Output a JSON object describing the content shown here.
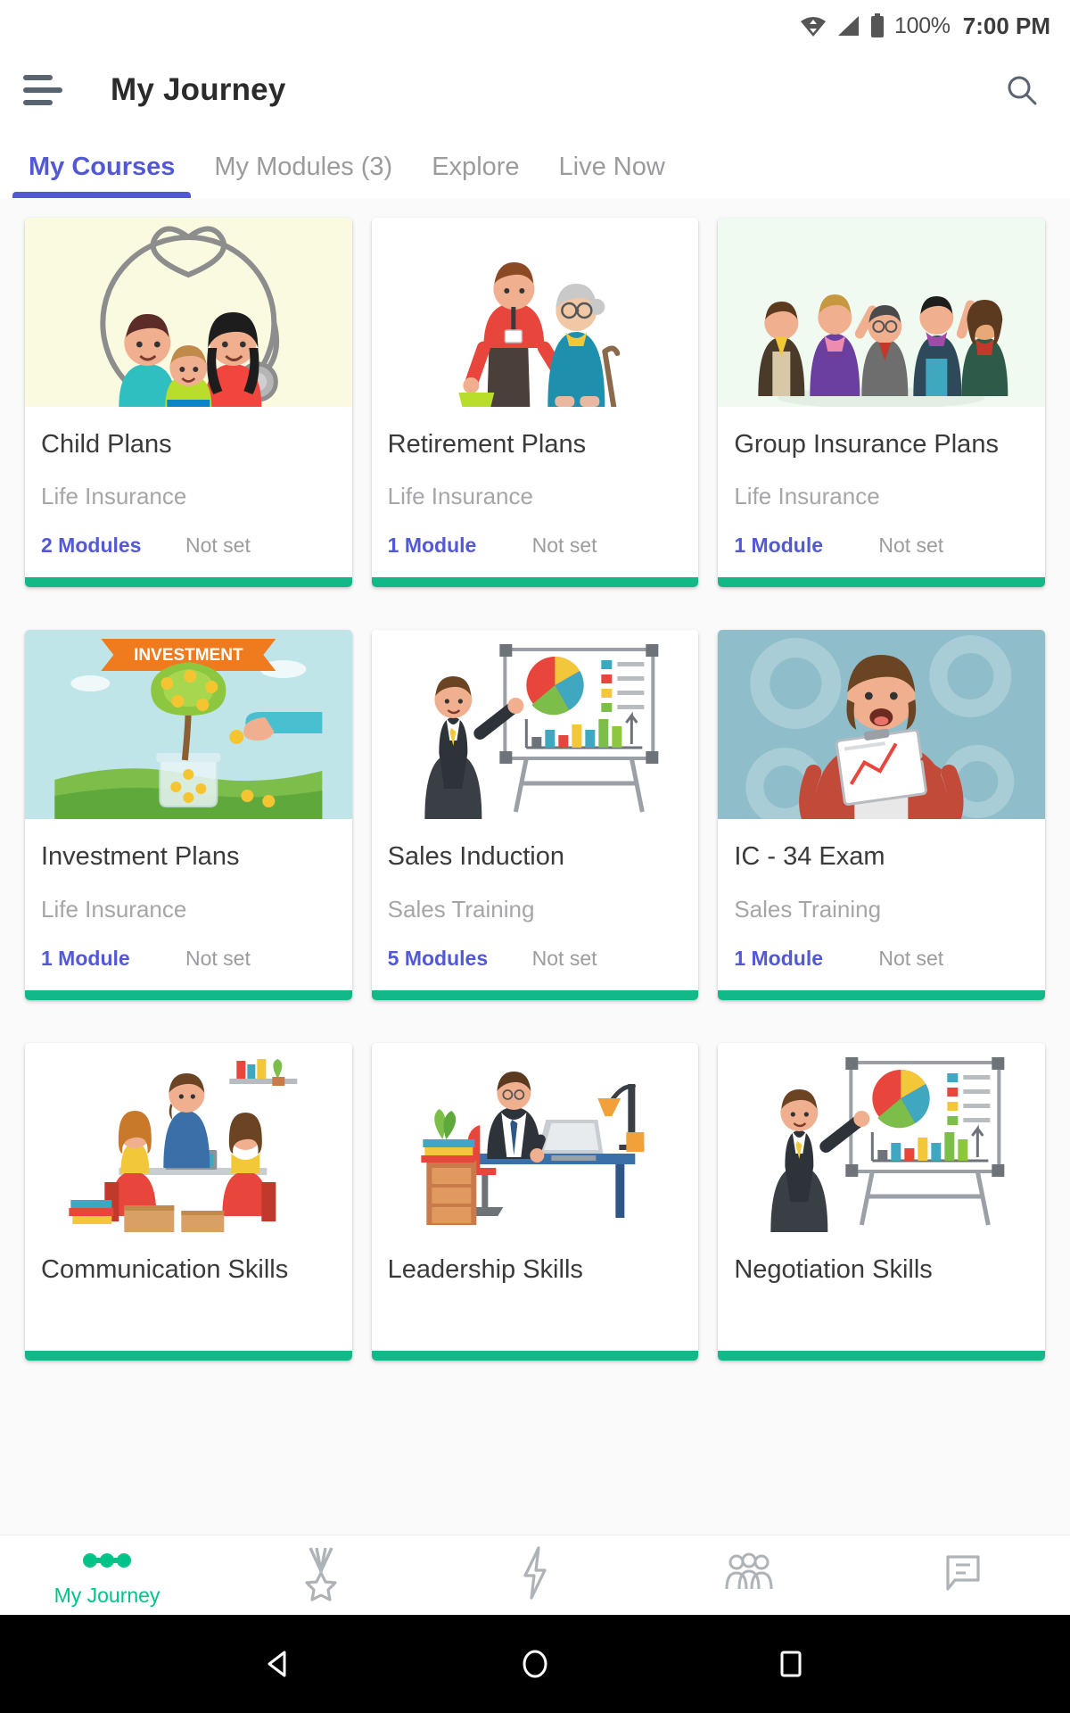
{
  "statusbar": {
    "wifi_icon": "wifi-icon",
    "signal_icon": "signal-icon",
    "battery_icon": "battery-icon",
    "battery_text": "100%",
    "time": "7:00 PM"
  },
  "appbar": {
    "menu_icon": "hamburger-menu-icon",
    "title": "My Journey",
    "search_icon": "search-icon"
  },
  "tabs": [
    {
      "label": "My Courses",
      "active": true
    },
    {
      "label": "My Modules (3)",
      "active": false
    },
    {
      "label": "Explore",
      "active": false
    },
    {
      "label": "Live Now",
      "active": false
    }
  ],
  "colors": {
    "accent_indigo": "#5359D6",
    "accent_green": "#00C389",
    "progress_green": "#13B888",
    "muted_text": "#a6a6a9",
    "title_text": "#3a3a3a"
  },
  "courses": [
    {
      "title": "Child Plans",
      "category": "Life Insurance",
      "modules": "2 Modules",
      "status": "Not set",
      "thumb": "family-stethoscope-illustration",
      "thumb_bg": "#FAFAE0"
    },
    {
      "title": "Retirement Plans",
      "category": "Life Insurance",
      "modules": "1 Module",
      "status": "Not set",
      "thumb": "caregiver-elderly-illustration",
      "thumb_bg": "#FFFFFF"
    },
    {
      "title": "Group Insurance Plans",
      "category": "Life Insurance",
      "modules": "1 Module",
      "status": "Not set",
      "thumb": "business-team-illustration",
      "thumb_bg": "#F1FAF1"
    },
    {
      "title": "Investment Plans",
      "category": "Life Insurance",
      "modules": "1 Module",
      "status": "Not set",
      "thumb": "money-tree-investment-illustration",
      "thumb_bg": "#BFE5E8"
    },
    {
      "title": "Sales Induction",
      "category": "Sales Training",
      "modules": "5 Modules",
      "status": "Not set",
      "thumb": "presenter-charts-illustration",
      "thumb_bg": "#FFFFFF"
    },
    {
      "title": "IC - 34 Exam",
      "category": "Sales Training",
      "modules": "1 Module",
      "status": "Not set",
      "thumb": "man-clipboard-illustration",
      "thumb_bg": "#8FBDC9"
    },
    {
      "title": "Communication Skills",
      "category": "",
      "modules": "",
      "status": "",
      "thumb": "team-meeting-illustration",
      "thumb_bg": "#FFFFFF"
    },
    {
      "title": "Leadership Skills",
      "category": "",
      "modules": "",
      "status": "",
      "thumb": "office-desk-illustration",
      "thumb_bg": "#FFFFFF"
    },
    {
      "title": "Negotiation Skills",
      "category": "",
      "modules": "",
      "status": "",
      "thumb": "presenter-charts-illustration",
      "thumb_bg": "#FFFFFF"
    }
  ],
  "bottomnav": [
    {
      "icon": "journey-path-icon",
      "label": "My Journey",
      "active": true
    },
    {
      "icon": "medal-icon",
      "label": "",
      "active": false
    },
    {
      "icon": "lightning-bolt-icon",
      "label": "",
      "active": false
    },
    {
      "icon": "people-group-icon",
      "label": "",
      "active": false
    },
    {
      "icon": "chat-message-icon",
      "label": "",
      "active": false
    }
  ],
  "androidnav": {
    "back_icon": "back-triangle-icon",
    "home_icon": "home-circle-icon",
    "recents_icon": "recents-square-icon"
  }
}
